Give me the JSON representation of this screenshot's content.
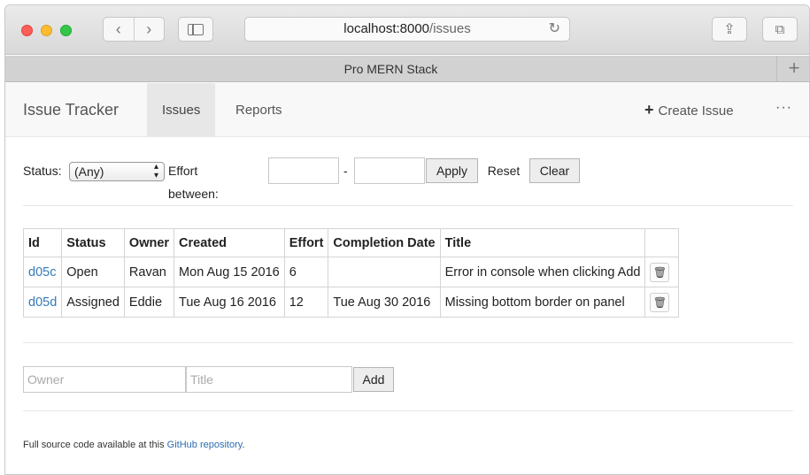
{
  "browser": {
    "url_host": "localhost:8000",
    "url_path": "/issues",
    "tab_title": "Pro MERN Stack",
    "back_glyph": "‹",
    "forward_glyph": "›",
    "reload_glyph": "↻",
    "share_glyph": "⇪",
    "tabs_glyph": "⧉",
    "new_tab_glyph": "+"
  },
  "navbar": {
    "brand": "Issue Tracker",
    "items": [
      {
        "label": "Issues",
        "active": true
      },
      {
        "label": "Reports",
        "active": false
      }
    ],
    "create_issue_label": "Create Issue",
    "plus_glyph": "+",
    "more_glyph": "···"
  },
  "filter": {
    "status_label": "Status:",
    "status_value": "(Any)",
    "select_arrows": "▴\n▾",
    "effort_label": "Effort between:",
    "effort_separator": "-",
    "effort_min": "",
    "effort_max": "",
    "apply_label": "Apply",
    "reset_label": "Reset",
    "clear_label": "Clear"
  },
  "table": {
    "headers": [
      "Id",
      "Status",
      "Owner",
      "Created",
      "Effort",
      "Completion Date",
      "Title",
      ""
    ],
    "rows": [
      {
        "id": "d05c",
        "status": "Open",
        "owner": "Ravan",
        "created": "Mon Aug 15 2016",
        "effort": "6",
        "completion": "",
        "title": "Error in console when clicking Add"
      },
      {
        "id": "d05d",
        "status": "Assigned",
        "owner": "Eddie",
        "created": "Tue Aug 16 2016",
        "effort": "12",
        "completion": "Tue Aug 30 2016",
        "title": "Missing bottom border on panel"
      }
    ],
    "trash_glyph": "🗑"
  },
  "add_form": {
    "owner_placeholder": "Owner",
    "title_placeholder": "Title",
    "add_label": "Add"
  },
  "footer": {
    "text": "Full source code available at this ",
    "link_text": "GitHub repository",
    "suffix": "."
  },
  "colors": {
    "link": "#337ab7",
    "navbar_bg": "#f8f8f8",
    "active_nav_bg": "#e7e7e7",
    "traffic_red": "#fc5f57",
    "traffic_yellow": "#fdbc2e",
    "traffic_green": "#33c748"
  }
}
